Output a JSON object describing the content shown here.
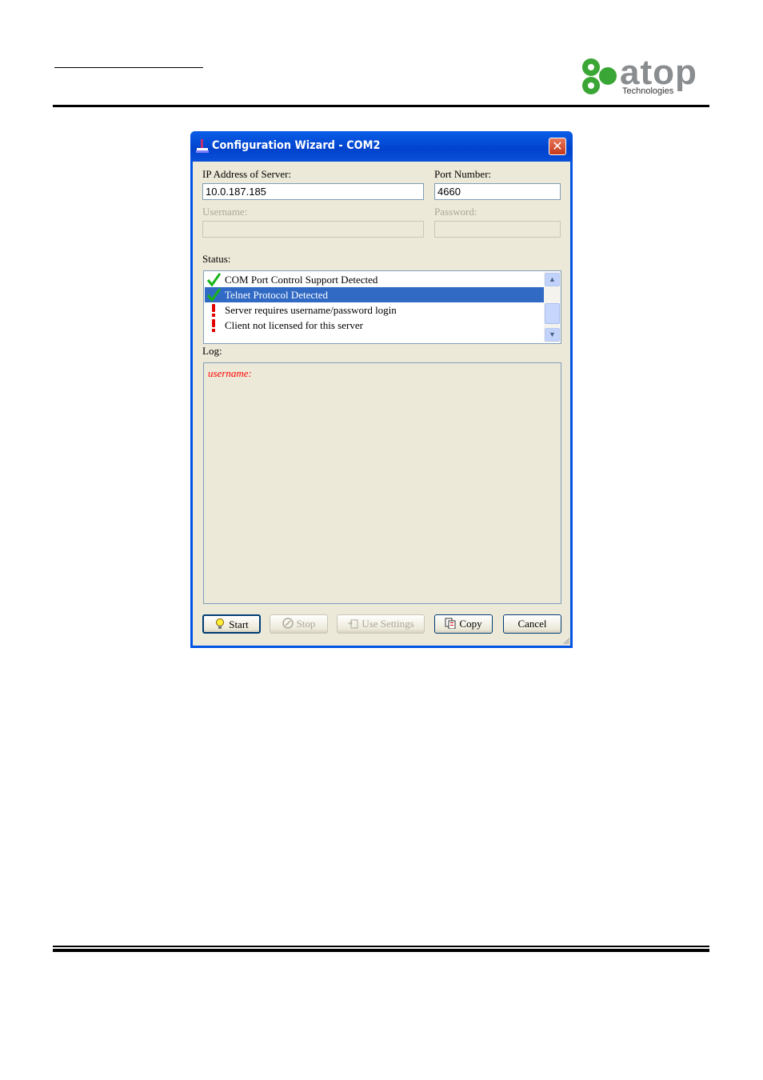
{
  "page": {
    "logo_text": "atop",
    "logo_subtext": "Technologies"
  },
  "window": {
    "title": "Configuration Wizard - COM2",
    "close_label": "✕"
  },
  "form": {
    "ip_label": "IP Address of Server:",
    "ip_value": "10.0.187.185",
    "port_label": "Port Number:",
    "port_value": "4660",
    "username_label": "Username:",
    "username_value": "",
    "password_label": "Password:",
    "password_value": ""
  },
  "status": {
    "label": "Status:",
    "items": [
      {
        "icon": "checkmark-icon",
        "text": "COM Port Control Support Detected",
        "selected": false
      },
      {
        "icon": "checkmark-icon",
        "text": "Telnet Protocol Detected",
        "selected": true
      },
      {
        "icon": "exclamation-icon",
        "text": "Server requires username/password login",
        "selected": false
      },
      {
        "icon": "exclamation-icon",
        "text": "Client not licensed for this server",
        "selected": false
      }
    ]
  },
  "log": {
    "label": "Log:",
    "text": "username:"
  },
  "buttons": {
    "start": "Start",
    "stop": "Stop",
    "use_settings": "Use Settings",
    "copy": "Copy",
    "cancel": "Cancel"
  },
  "colors": {
    "titlebar": "#0054e3",
    "selection": "#316ac5",
    "log_text": "#ff0000",
    "dialog_bg": "#ece9d8"
  }
}
